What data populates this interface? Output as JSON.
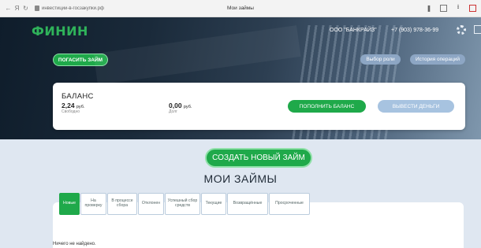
{
  "browser": {
    "address": "инвестиции-в-госзакупки.рф",
    "title": "Мои займы"
  },
  "header": {
    "logo": "ФИНИН",
    "company": "ООО \"БАНКРАЙЗ\"",
    "phone": "+7 (903) 978-36-99"
  },
  "hero": {
    "pay_loan": "ПОГАСИТЬ ЗАЙМ",
    "role_select": "Выбор роли",
    "history": "История операций"
  },
  "balance": {
    "title": "БАЛАНС",
    "free_value": "2,24",
    "free_unit": "руб.",
    "free_label": "Свободно",
    "debt_value": "0,00",
    "debt_unit": "руб.",
    "debt_label": "Долг",
    "topup": "ПОПОЛНИТЬ БАЛАНС",
    "withdraw": "ВЫВЕСТИ ДЕНЬГИ"
  },
  "main": {
    "create_loan": "СОЗДАТЬ НОВЫЙ ЗАЙМ",
    "title": "МОИ ЗАЙМЫ",
    "tabs": [
      {
        "label": "Новые",
        "active": true
      },
      {
        "label": "На проверку"
      },
      {
        "label": "В процессе сбора"
      },
      {
        "label": "Отклонен"
      },
      {
        "label": "Успешный сбор средств"
      },
      {
        "label": "Текущие"
      },
      {
        "label": "Возвращённые"
      },
      {
        "label": "Просроченные"
      }
    ],
    "empty": "Ничего не найдено."
  },
  "colors": {
    "accent_green": "#1fa94a",
    "secondary_blue": "#8da6c4"
  },
  "icons": {
    "back": "←",
    "forward": "Я",
    "reload": "↻",
    "bookmark": "❚",
    "download": "⭳"
  }
}
